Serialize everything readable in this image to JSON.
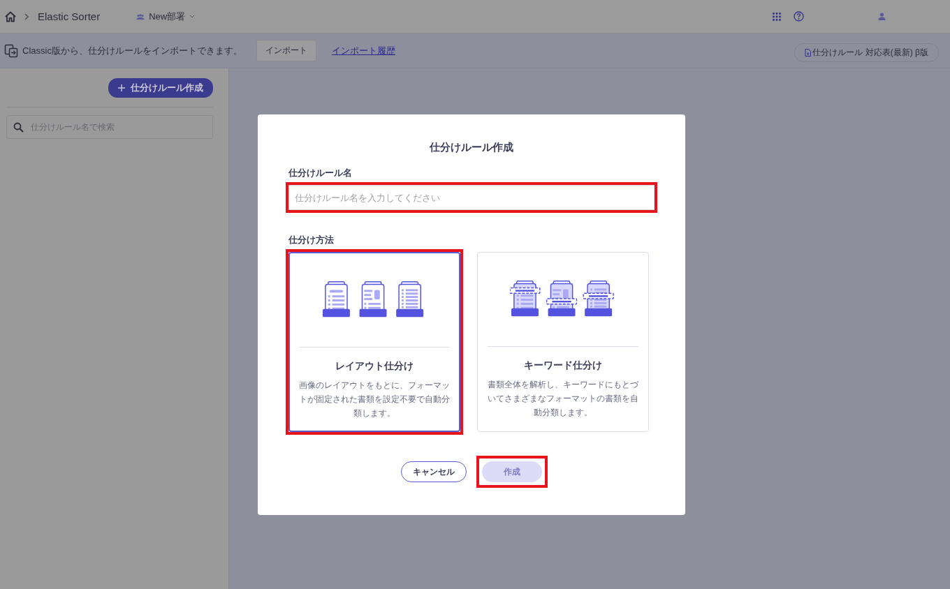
{
  "header": {
    "app_name": "Elastic Sorter",
    "department": "New部署"
  },
  "import_bar": {
    "message": "Classic版から、仕分けルールをインポートできます。",
    "import_button": "インポート",
    "history_link": "インポート履歴",
    "table_button": "仕分けルール 対応表(最新) β版"
  },
  "sidebar": {
    "create_button": "仕分けルール作成",
    "search": {
      "placeholder": "仕分けルール名で検索"
    }
  },
  "dialog": {
    "title": "仕分けルール作成",
    "name_label": "仕分けルール名",
    "name_field": {
      "placeholder": "仕分けルール名を入力してください",
      "highlighted": true
    },
    "method_label": "仕分け方法",
    "methods": [
      {
        "kind": "layout",
        "title": "レイアウト仕分け",
        "description": "画像のレイアウトをもとに、フォーマットが固定された書類を設定不要で自動分類します。",
        "selected": true,
        "highlighted": true
      },
      {
        "kind": "keyword",
        "title": "キーワード仕分け",
        "description": "書類全体を解析し、キーワードにもとづいてさまざまなフォーマットの書類を自動分類します。",
        "selected": false,
        "highlighted": false
      }
    ],
    "buttons": [
      {
        "kind": "cancel",
        "label": "キャンセル",
        "disabled": false,
        "highlighted": false
      },
      {
        "kind": "primary",
        "label": "作成",
        "disabled": true,
        "highlighted": true
      }
    ]
  }
}
